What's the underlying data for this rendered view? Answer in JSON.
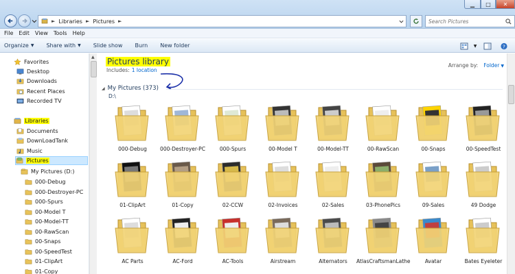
{
  "address": {
    "crumbs": [
      "Libraries",
      "Pictures"
    ]
  },
  "search": {
    "placeholder": "Search Pictures"
  },
  "menu": [
    "File",
    "Edit",
    "View",
    "Tools",
    "Help"
  ],
  "toolbar": {
    "organize": "Organize",
    "share_with": "Share with",
    "slide_show": "Slide show",
    "burn": "Burn",
    "new_folder": "New folder"
  },
  "nav": {
    "favorites": "Favorites",
    "desktop": "Desktop",
    "downloads": "Downloads",
    "recent_places": "Recent Places",
    "recorded_tv": "Recorded TV",
    "libraries": "Libraries",
    "documents": "Documents",
    "downloadtank": "DownLoadTank",
    "music": "Music",
    "pictures": "Pictures",
    "my_pictures": "My Pictures (D:)",
    "subfolders": [
      "000-Debug",
      "000-Destroyer-PC",
      "000-Spurs",
      "00-Model T",
      "00-Model-TT",
      "00-RawScan",
      "00-Snaps",
      "00-SpeedTest",
      "01-ClipArt",
      "01-Copy"
    ]
  },
  "library": {
    "title": "Pictures library",
    "includes_label": "Includes:",
    "includes_link": "1 location",
    "arrange_label": "Arrange by:",
    "arrange_value": "Folder",
    "group_header": "My Pictures (373)",
    "group_path": "D:\\"
  },
  "folders": [
    "000-Debug",
    "000-Destroyer-PC",
    "000-Spurs",
    "00-Model T",
    "00-Model-TT",
    "00-RawScan",
    "00-Snaps",
    "00-SpeedTest",
    "01-ClipArt",
    "01-Copy",
    "02-CCW",
    "02-Invoices",
    "02-Sales",
    "03-PhonePics",
    "09-Sales",
    "49 Dodge",
    "AC Parts",
    "AC-Ford",
    "AC-Tools",
    "Airstream",
    "Alternators",
    "AtlasCraftsmanLathe",
    "Avatar",
    "Bates Eyeleter"
  ],
  "colors": {
    "highlight": "#ffff00",
    "link": "#0066cc",
    "heading": "#1e395b",
    "annotation_pen": "#1a2fa8"
  }
}
